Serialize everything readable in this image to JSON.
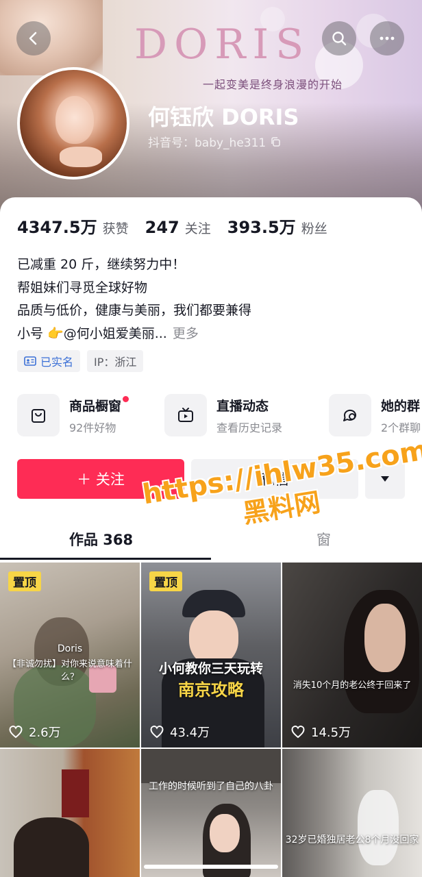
{
  "header": {
    "brand_text": "DORIS",
    "slogan": "一起变美是终身浪漫的开始",
    "display_name": "何钰欣 DORIS",
    "douyin_id": "抖音号：baby_he311"
  },
  "stats": [
    {
      "value": "4347.5万",
      "label": "获赞"
    },
    {
      "value": "247",
      "label": "关注"
    },
    {
      "value": "393.5万",
      "label": "粉丝"
    }
  ],
  "bio": {
    "lines": [
      "已减重 20 斤，继续努力中！",
      "帮姐妹们寻觅全球好物",
      "品质与低价，健康与美丽，我们都要兼得",
      "小号 👉@何小姐爱美丽..."
    ],
    "more": "更多"
  },
  "tags": {
    "verified": "已实名",
    "ip": "IP：浙江"
  },
  "services": [
    {
      "title": "商品橱窗",
      "sub": "92件好物",
      "icon": "shopping-bag-icon"
    },
    {
      "title": "直播动态",
      "sub": "查看历史记录",
      "icon": "tv-icon"
    },
    {
      "title": "她的群",
      "sub": "2个群聊",
      "icon": "chat-group-icon"
    }
  ],
  "actions": {
    "follow": "＋ 关注",
    "message": "私信"
  },
  "tabs": {
    "works": "作品 368",
    "showcase": "窗"
  },
  "videos": [
    {
      "pinned": "置顶",
      "likes": "2.6万",
      "caption_top": "Doris",
      "caption": "【非诚勿扰】对你来说意味着什么？"
    },
    {
      "pinned": "置顶",
      "likes": "43.4万",
      "caption": "小何教你三天玩转",
      "caption2": "南京攻略"
    },
    {
      "likes": "14.5万",
      "caption": "消失10个月的老公终于回来了"
    },
    {},
    {
      "caption": "工作的时候听到了自己的八卦"
    },
    {
      "caption": "32岁已婚独居老公8个月没回家"
    }
  ],
  "watermark": {
    "url": "https://ihlw35.com",
    "cn": "黑料网"
  },
  "colors": {
    "accent": "#fe2c55",
    "pin": "#f7d547",
    "watermark": "#f7a21b"
  }
}
